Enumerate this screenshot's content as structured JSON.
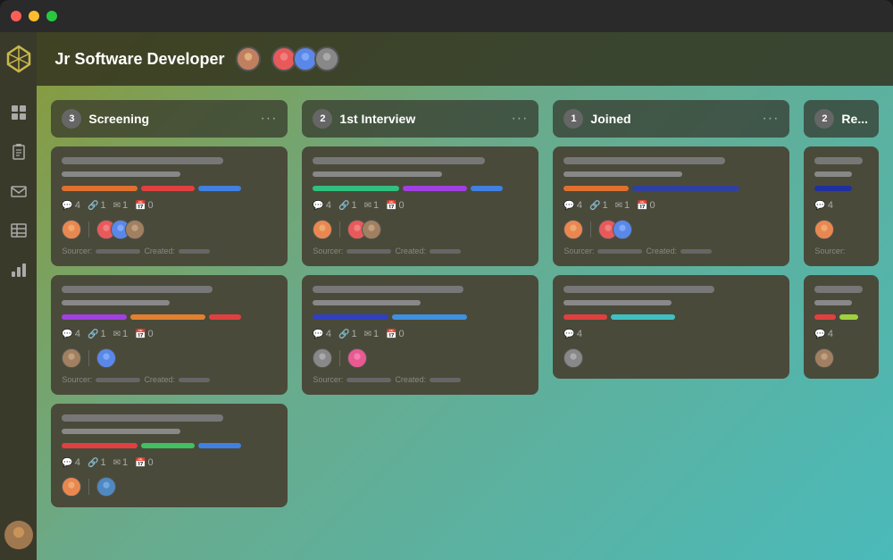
{
  "titleBar": {
    "trafficLights": [
      "red",
      "yellow",
      "green"
    ]
  },
  "header": {
    "title": "Jr Software Developer",
    "avatarCount": 4
  },
  "sidebar": {
    "items": [
      {
        "name": "grid-icon",
        "label": "Grid"
      },
      {
        "name": "clipboard-icon",
        "label": "Clipboard"
      },
      {
        "name": "mail-icon",
        "label": "Mail"
      },
      {
        "name": "table-icon",
        "label": "Table"
      },
      {
        "name": "chart-icon",
        "label": "Chart"
      }
    ]
  },
  "columns": [
    {
      "id": "screening",
      "count": "3",
      "title": "Screening",
      "cards": [
        {
          "bars": [
            {
              "color": "#e07030",
              "width": "35%"
            },
            {
              "color": "#e04040",
              "width": "25%"
            },
            {
              "color": "#4080e0",
              "width": "20%"
            }
          ],
          "comments": "4",
          "attachments": "1",
          "mail": "1",
          "calendar": "0",
          "avatars": [
            "av1",
            "av2",
            "av3"
          ],
          "sourcer": true
        },
        {
          "bars": [
            {
              "color": "#a040e0",
              "width": "30%"
            },
            {
              "color": "#e08030",
              "width": "35%"
            },
            {
              "color": "#e04040",
              "width": "15%"
            }
          ],
          "comments": "4",
          "attachments": "1",
          "mail": "1",
          "calendar": "0",
          "avatars": [
            "av5",
            "av2"
          ],
          "sourcer": true
        },
        {
          "bars": [
            {
              "color": "#e04040",
              "width": "35%"
            },
            {
              "color": "#40c060",
              "width": "25%"
            },
            {
              "color": "#4080e0",
              "width": "20%"
            }
          ],
          "comments": "4",
          "attachments": "1",
          "mail": "1",
          "calendar": "0",
          "avatars": [
            "av1",
            "av6"
          ],
          "sourcer": false
        }
      ]
    },
    {
      "id": "first-interview",
      "count": "2",
      "title": "1st Interview",
      "cards": [
        {
          "bars": [
            {
              "color": "#30c080",
              "width": "40%"
            },
            {
              "color": "#a040e0",
              "width": "30%"
            },
            {
              "color": "#4080e0",
              "width": "15%"
            }
          ],
          "comments": "4",
          "attachments": "1",
          "mail": "1",
          "calendar": "0",
          "avatars": [
            "av1",
            "av3",
            "av5"
          ],
          "sourcer": true
        },
        {
          "bars": [
            {
              "color": "#3040c0",
              "width": "35%"
            },
            {
              "color": "#4080e0",
              "width": "35%"
            }
          ],
          "comments": "4",
          "attachments": "1",
          "mail": "1",
          "calendar": "0",
          "avatars": [
            "av7",
            "av3"
          ],
          "sourcer": true
        }
      ]
    },
    {
      "id": "joined",
      "count": "1",
      "title": "Joined",
      "cards": [
        {
          "bars": [
            {
              "color": "#e07030",
              "width": "30%"
            },
            {
              "color": "#3040a0",
              "width": "50%"
            }
          ],
          "comments": "4",
          "attachments": "1",
          "mail": "1",
          "calendar": "0",
          "avatars": [
            "av1",
            "av2",
            "av3"
          ],
          "sourcer": true
        },
        {
          "bars": [
            {
              "color": "#e04040",
              "width": "20%"
            },
            {
              "color": "#40c0c0",
              "width": "30%"
            }
          ],
          "comments": "4",
          "avatars": [
            "av4"
          ],
          "sourcer": false
        }
      ]
    }
  ],
  "partialColumn": {
    "count": "2",
    "title": "Re..."
  },
  "labels": {
    "sourcer": "Sourcer:",
    "created": "Created:",
    "dotsMenu": "...",
    "commentIcon": "💬",
    "attachIcon": "🔗",
    "mailIcon": "✉",
    "calIcon": "📅"
  }
}
